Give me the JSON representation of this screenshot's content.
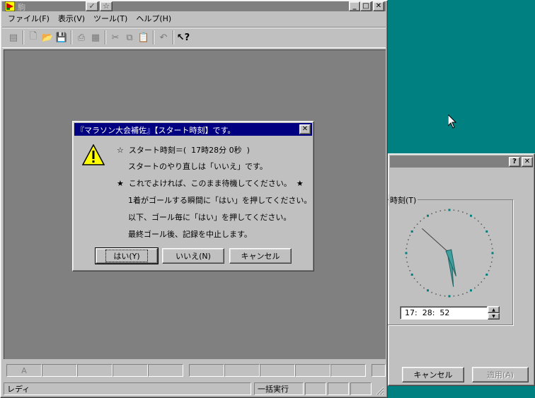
{
  "main_window": {
    "title": "駒",
    "menu": [
      "ファイル(F)",
      "表示(V)",
      "ツール(T)",
      "ヘルプ(H)"
    ],
    "status": {
      "left": "レディ",
      "middle": "一括実行",
      "tab_label": "A"
    }
  },
  "dialog": {
    "title": "『マラソン大会補佐』【スタート時刻】です。",
    "lines": [
      "☆  スタート時刻＝(  17時28分 0秒  )",
      "スタートのやり直しは「いいえ」です。",
      "★  これでよければ、このまま待機してください。  ★",
      "1着がゴールする瞬間に「はい」を押してください。",
      "以下、ゴール毎に「はい」を押してください。",
      "最終ゴール後、記録を中止します。"
    ],
    "buttons": {
      "yes": "はい(Y)",
      "no": "いいえ(N)",
      "cancel": "キャンセル"
    }
  },
  "time_panel": {
    "group_label": "時刻(T)",
    "time_value": "17:  28:  52",
    "clock": {
      "hour": 17,
      "minute": 28,
      "second": 52
    },
    "buttons": {
      "cancel": "キャンセル",
      "apply": "適用(A)"
    }
  },
  "colors": {
    "desktop": "#008080",
    "titlebar_active": "#000080",
    "face": "#c0c0c0",
    "workspace": "#808080",
    "clock_dot": "#008080"
  }
}
